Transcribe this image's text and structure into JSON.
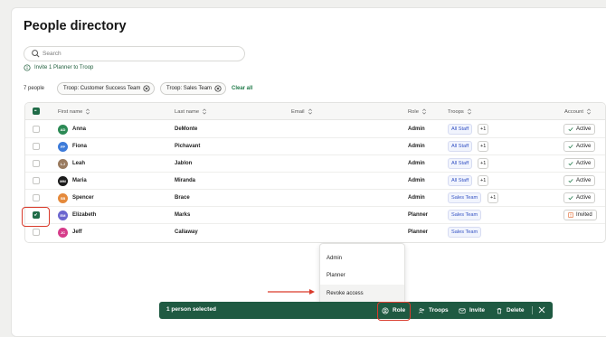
{
  "page": {
    "title": "People directory"
  },
  "search": {
    "placeholder": "Search"
  },
  "invite_link": {
    "label": "Invite 1 Planner to Troop"
  },
  "filters": {
    "count_label": "7 people",
    "chips": [
      "Troop: Customer Success Team",
      "Troop: Sales Team"
    ],
    "clear_label": "Clear all"
  },
  "table": {
    "columns": [
      "First name",
      "Last name",
      "Email",
      "Role",
      "Troops",
      "Account"
    ],
    "rows": [
      {
        "initials": "AD",
        "avatar_color": "#2c8a55",
        "first": "Anna",
        "last": "DeMonte",
        "role": "Admin",
        "troop": "All Staff",
        "extra": "+1",
        "account": "Active",
        "selected": false
      },
      {
        "initials": "FP",
        "avatar_color": "#3d7bd9",
        "first": "Fiona",
        "last": "Pichavant",
        "role": "Admin",
        "troop": "All Staff",
        "extra": "+1",
        "account": "Active",
        "selected": false
      },
      {
        "initials": "LJ",
        "avatar_color": "#9a7b5f",
        "first": "Leah",
        "last": "Jablon",
        "role": "Admin",
        "troop": "All Staff",
        "extra": "+1",
        "account": "Active",
        "selected": false
      },
      {
        "initials": "MM",
        "avatar_color": "#1b1b1b",
        "first": "Maria",
        "last": "Miranda",
        "role": "Admin",
        "troop": "All Staff",
        "extra": "+1",
        "account": "Active",
        "selected": false
      },
      {
        "initials": "SB",
        "avatar_color": "#e58a3c",
        "first": "Spencer",
        "last": "Brace",
        "role": "Admin",
        "troop": "Sales Team",
        "extra": "+1",
        "account": "Active",
        "selected": false
      },
      {
        "initials": "EM",
        "avatar_color": "#6b66cf",
        "first": "Elizabeth",
        "last": "Marks",
        "role": "Planner",
        "troop": "Sales Team",
        "extra": "",
        "account": "Invited",
        "selected": true
      },
      {
        "initials": "JC",
        "avatar_color": "#d63c8a",
        "first": "Jeff",
        "last": "Callaway",
        "role": "Planner",
        "troop": "Sales Team",
        "extra": "",
        "account": "",
        "selected": false
      }
    ]
  },
  "role_menu": {
    "items": [
      "Admin",
      "Planner",
      "Revoke access"
    ]
  },
  "action_bar": {
    "selection_label": "1 person selected",
    "role": "Role",
    "troops": "Troops",
    "invite": "Invite",
    "delete": "Delete"
  },
  "colors": {
    "accent": "#1f5a42",
    "annotation": "#d93a2b",
    "invited": "#e0672d"
  }
}
